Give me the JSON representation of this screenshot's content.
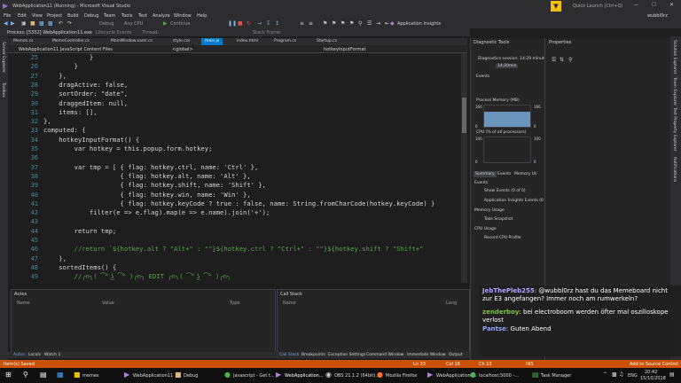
{
  "window": {
    "title": "WebApplication11 (Running) - Microsoft Visual Studio",
    "quick_launch": "Quick Launch (Ctrl+Q)",
    "user": "wubbl0rz",
    "filter_icon": "filter-icon"
  },
  "menu": [
    "File",
    "Edit",
    "View",
    "Project",
    "Build",
    "Debug",
    "Team",
    "Tools",
    "Test",
    "Analyze",
    "Window",
    "Help"
  ],
  "toolbar": {
    "config": "Debug",
    "platform": "Any CPU",
    "continue": "Continue",
    "app_insights": "Application Insights",
    "lifecycle": "Lifecycle Events",
    "thread": "Thread:",
    "stack_frame": "Stack Frame:"
  },
  "process": {
    "label": "Process:",
    "value": "[5352] WebApplication11.exe"
  },
  "tabs": [
    "Memes.cs",
    "MemeController.cs",
    "MainWindow.xaml.cs",
    "style.css",
    "main.js",
    "index.html",
    "Program.cs",
    "Startup.cs"
  ],
  "active_tab": "main.js",
  "navbar": {
    "project": "WebApplication11 JavaScript Content Files",
    "scope": "<global>",
    "member": "hotkeyInputFormat"
  },
  "code": {
    "line_numbers": [
      "25",
      "26",
      "27",
      "28",
      "29",
      "30",
      "31",
      "32",
      "33",
      "34",
      "35",
      "36",
      "37",
      "38",
      "39",
      "40",
      "41",
      "42",
      "43",
      "44",
      "45",
      "46",
      "47",
      "48",
      "49"
    ],
    "lines": [
      "            }",
      "        }",
      "    },",
      "    dragActive: false,",
      "    sortOrder: \"date\",",
      "    draggedItem: null,",
      "    items: [],",
      "},",
      "computed: {",
      "    hotkeyInputFormat() {",
      "        var hotkey = this.popup.form.hotkey;",
      "",
      "        var tmp = [ { flag: hotkey.ctrl, name: 'Ctrl' },",
      "                    { flag: hotkey.alt, name: 'Alt' },",
      "                    { flag: hotkey.shift, name: 'Shift' },",
      "                    { flag: hotkey.win, name: 'Win' },",
      "                    { flag: hotkey.keyCode ? true : false, name: String.fromCharCode(hotkey.keyCode) }",
      "            filter(e => e.flag).map(e => e.name).join('+');",
      "",
      "        return tmp;",
      "",
      "        //return `${hotkey.alt ? \"Alt+\" : \"\"}${hotkey.ctrl ? \"Ctrl+\" : \"\"}${hotkey.shift ? \"Shift+\"",
      "    },",
      "    sortedItems() {",
      "        //╭∩╮( ͡° ͜ʖ ͡° )╭∩╮ EDIT ╭∩╮( ͡° ͜ʖ ͡° )╭∩╮"
    ]
  },
  "diagnostics": {
    "title": "Diagnostic Tools",
    "session": "Diagnostics session: 14:29 minutes",
    "time": "14:20min",
    "events": "Events",
    "memory": "Process Memory (MB)",
    "cpu": "CPU (% of all processors)",
    "mem_max": "166",
    "mem_min": "0",
    "cpu_max": "100",
    "cpu_min": "0",
    "memory_level": 0.7,
    "tabs": [
      "Summary",
      "Events",
      "Memory Us"
    ],
    "events_section": "Events",
    "show_events": "Show Events (0 of 0)",
    "app_insights_events": "Application Insights Events (0 of 0)",
    "memory_usage": "Memory Usage",
    "take_snapshot": "Take Snapshot",
    "cpu_usage": "CPU Usage",
    "record_cpu": "Record CPU Profile"
  },
  "properties": {
    "title": "Properties"
  },
  "right_strip": [
    "Solution Explorer",
    "Team Explorer",
    "Test Property Explorer",
    "Notifications"
  ],
  "left_strip": [
    "Server Explorer",
    "Toolbox"
  ],
  "autos": {
    "title": "Autos",
    "cols": [
      "Name",
      "Value",
      "Type"
    ]
  },
  "callstack": {
    "title": "Call Stack",
    "cols": [
      "Name",
      "Lang"
    ]
  },
  "bottom_tabs_left": [
    "Autos",
    "Locals",
    "Watch 1"
  ],
  "bottom_tabs_right": [
    "Call Stack",
    "Breakpoints",
    "Exception Settings",
    "Command Window",
    "Immediate Window",
    "Output"
  ],
  "status": {
    "msg": "Item(s) Saved",
    "ln": "Ln 33",
    "col": "Col 16",
    "ch": "Ch 13",
    "ins": "INS",
    "source": "Add to Source Control"
  },
  "chat": [
    {
      "user": "JebThePleb255",
      "text": "@wubbl0rz hast du das Memeboard nicht zur E3 angefangen? Immer noch am rumwerkeln?",
      "color": "#b3a6ff"
    },
    {
      "user": "zenderboy",
      "text": "bei electroboom werden öfter mal oszilloskope verlost",
      "color": "#7ec242"
    },
    {
      "user": "Pantse",
      "text": "Guten Abend",
      "color": "#8fa8ff"
    }
  ],
  "taskbar": {
    "items": [
      "memes",
      "WebApplication11",
      "Debug",
      "javascript - Get t...",
      "WebApplication...",
      "OBS 21.1.2 (64bit)...",
      "Mozilla Firefox",
      "WebApplication11",
      "localhost:5000 -...",
      "Task Manager"
    ],
    "lang": "ENG",
    "time": "20:42",
    "date": "15/10/2018"
  },
  "colors": {
    "accent": "#007acc",
    "status": "#ca5100",
    "chrome": "#2d2d30"
  }
}
